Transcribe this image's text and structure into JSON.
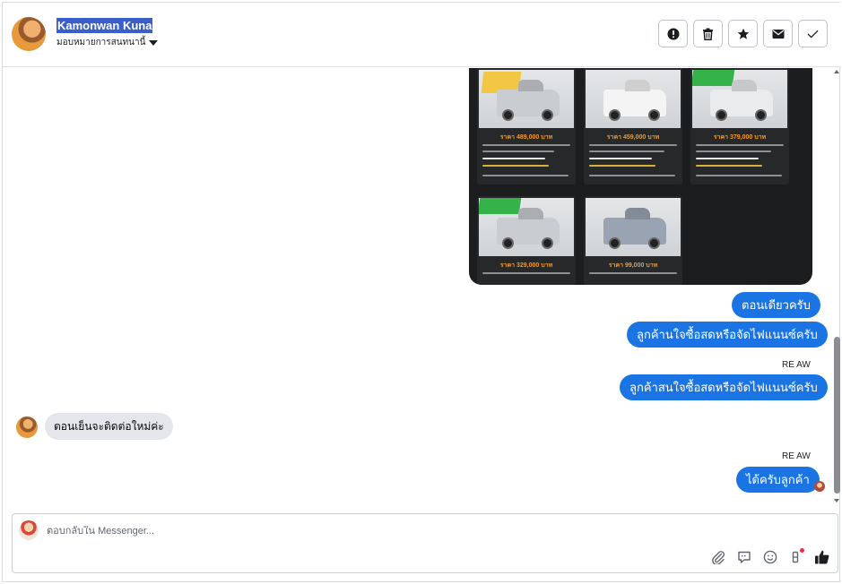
{
  "header": {
    "contact_name": "Kamonwan Kuna",
    "assign_label": "มอบหมายการสนทนานี้"
  },
  "header_actions": [
    {
      "name": "mark-spam-button",
      "icon": "exclamation-icon"
    },
    {
      "name": "delete-button",
      "icon": "trash-icon"
    },
    {
      "name": "star-button",
      "icon": "star-icon"
    },
    {
      "name": "mark-unread-button",
      "icon": "envelope-icon"
    },
    {
      "name": "mark-done-button",
      "icon": "check-icon"
    }
  ],
  "image_listings": [
    {
      "price": "ราคา 489,000 บาท",
      "color": "#c9ccd0"
    },
    {
      "price": "ราคา 459,000 บาท",
      "color": "#f4f4f4"
    },
    {
      "price": "ราคา 379,000 บาท",
      "color": "#e9ebec"
    },
    {
      "price": "ราคา 329,000 บาท",
      "color": "#c9ccd0"
    },
    {
      "price": "ราคา 99,000 บาท",
      "color": "#9aa3b2"
    }
  ],
  "messages": {
    "out_1": "ตอนเดียวครับ",
    "out_2": "ลูกค้านใจซื้อสดหรือจัดไฟแนนซ์ครับ",
    "sender_1": "RE AW",
    "out_3": "ลูกค้าสนใจซื้อสดหรือจัดไฟแนนซ์ครับ",
    "in_1": "ตอนเย็นจะติดต่อใหม่ค่ะ",
    "sender_2": "RE AW",
    "out_4": "ได้ครับลูกค้า"
  },
  "composer": {
    "placeholder": "ตอบกลับใน Messenger..."
  },
  "colors": {
    "accent": "#1b74e4",
    "incoming_bubble": "#e4e6eb"
  }
}
